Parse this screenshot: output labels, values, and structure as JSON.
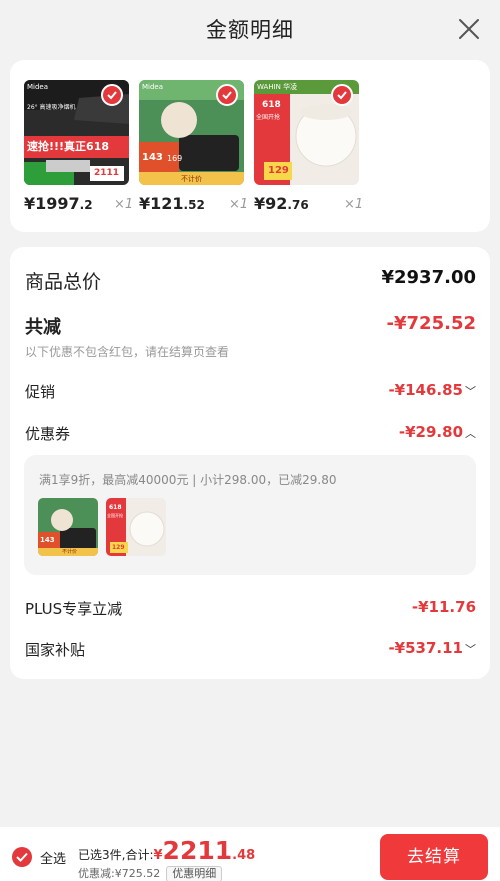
{
  "header": {
    "title": "金额明细"
  },
  "products": [
    {
      "price_int": "¥1997",
      "price_dec": ".2",
      "qty": "×1",
      "thumb_texts": [
        "Midea",
        "26° 高速吸净烟机",
        "速抢!!!真正618",
        "2111"
      ]
    },
    {
      "price_int": "¥121",
      "price_dec": ".52",
      "qty": "×1",
      "thumb_texts": [
        "Midea",
        "143",
        "169",
        "不计价"
      ]
    },
    {
      "price_int": "¥92",
      "price_dec": ".76",
      "qty": "×1",
      "thumb_texts": [
        "WAHIN 华凌",
        "618",
        "全国开抢",
        "129"
      ]
    }
  ],
  "summary": {
    "total_label": "商品总价",
    "total_value": "¥2937.00",
    "reduce_label": "共减",
    "reduce_value": "-¥725.52",
    "reduce_note": "以下优惠不包含红包，请在结算页查看",
    "promo_label": "促销",
    "promo_value": "-¥146.85",
    "coupon_label": "优惠券",
    "coupon_value": "-¥29.80",
    "coupon_detail": "满1享9折，最高减40000元 | 小计298.00，已减29.80",
    "coupon_thumbs": [
      {
        "texts": [
          "143",
          "不计价"
        ]
      },
      {
        "texts": [
          "618",
          "全国开抢",
          "129"
        ]
      }
    ],
    "plus_label": "PLUS专享立减",
    "plus_value": "-¥11.76",
    "subsidy_label": "国家补贴",
    "subsidy_value": "-¥537.11"
  },
  "bottom": {
    "select_all_label": "全选",
    "selected_prefix": "已选3件,合计:",
    "yen": "¥",
    "total_int": "2211",
    "total_dec": ".48",
    "discount_text": "优惠减:¥725.52",
    "detail_label": "优惠明细",
    "checkout_label": "去结算"
  },
  "colors": {
    "accent": "#e4393c",
    "checkout": "#f0393b"
  }
}
